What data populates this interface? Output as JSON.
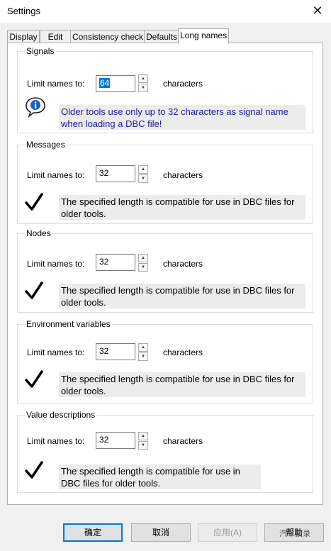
{
  "window": {
    "title": "Settings",
    "close_glyph": "✕"
  },
  "tabs": [
    {
      "label": "Display",
      "active": false
    },
    {
      "label": "Edit",
      "active": false
    },
    {
      "label": "Consistency check",
      "active": false
    },
    {
      "label": "Defaults",
      "active": false
    },
    {
      "label": "Long names",
      "active": true
    }
  ],
  "groups": [
    {
      "title": "Signals",
      "limit_label": "Limit names to:",
      "value": "64",
      "suffix": "characters",
      "message_icon": "info-icon",
      "message": "Older tools use only up to 32 characters as signal name when loading a DBC file!"
    },
    {
      "title": "Messages",
      "limit_label": "Limit names to:",
      "value": "32",
      "suffix": "characters",
      "message_icon": "checkmark-icon",
      "message": "The specified length is compatible for use in DBC files for older tools."
    },
    {
      "title": "Nodes",
      "limit_label": "Limit names to:",
      "value": "32",
      "suffix": "characters",
      "message_icon": "checkmark-icon",
      "message": "The specified length is compatible for use in DBC files for older tools."
    },
    {
      "title": "Environment variables",
      "limit_label": "Limit names to:",
      "value": "32",
      "suffix": "characters",
      "message_icon": "checkmark-icon",
      "message": "The specified length is compatible for use in DBC files for older tools."
    },
    {
      "title": "Value descriptions",
      "limit_label": "Limit names to:",
      "value": "32",
      "suffix": "characters",
      "message_icon": "checkmark-icon",
      "message": "The specified length is compatible for use in DBC files for older tools."
    }
  ],
  "buttons": {
    "ok": "确定",
    "cancel": "取消",
    "apply": "应用(A)",
    "help": "帮助"
  },
  "watermark": "汽车技录",
  "colors": {
    "accent": "#0078d7",
    "info_text": "#1a1aa0",
    "message_bg": "#ececec"
  }
}
